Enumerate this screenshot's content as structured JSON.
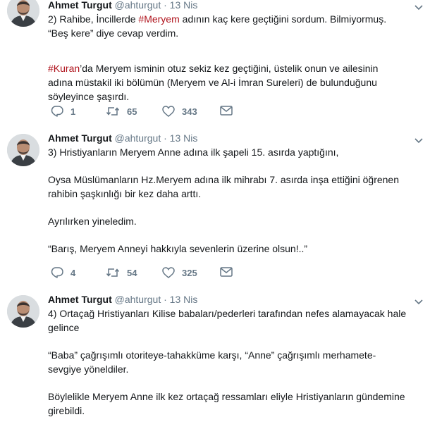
{
  "tweets": [
    {
      "author": "Ahmet Turgut",
      "handle": "@ahturgut",
      "separator": "·",
      "date": "13 Nis",
      "p1_a": "2) Rahibe, İncillerde ",
      "p1_hash": "#Meryem",
      "p1_b": " adının kaç kere geçtiğini sordum. Bilmiyormuş.",
      "p1_c": "“Beş kere” diye cevap verdim.",
      "p2_hash": "#Kuran",
      "p2_a": "’da Meryem isminin otuz sekiz kez geçtiğini, üstelik onun ve ailesinin",
      "p2_b": "adına müstakil iki bölümün (Meryem ve Al-i İmran Sureleri) de bulunduğunu",
      "p2_c": "söyleyince şaşırdı.",
      "replies": "1",
      "retweets": "65",
      "likes": "343"
    },
    {
      "author": "Ahmet Turgut",
      "handle": "@ahturgut",
      "separator": "·",
      "date": "13 Nis",
      "l1": "3) Hristiyanların Meryem Anne adına ilk şapeli 15. asırda yaptığını,",
      "l2": "Oysa Müslümanların Hz.Meryem adına ilk mihrabı 7. asırda inşa ettiğini öğrenen",
      "l3": "rahibin şaşkınlığı bir kez daha arttı.",
      "l4": "Ayrılırken yineledim.",
      "l5": "“Barış, Meryem Anneyi hakkıyla sevenlerin üzerine olsun!..”",
      "replies": "4",
      "retweets": "54",
      "likes": "325"
    },
    {
      "author": "Ahmet Turgut",
      "handle": "@ahturgut",
      "separator": "·",
      "date": "13 Nis",
      "l1": "4) Ortaçağ Hristiyanları Kilise babaları/pederleri tarafından nefes alamayacak hale",
      "l2": "gelince",
      "l3": "“Baba” çağrışımlı otoriteye-tahakküme karşı, “Anne” çağrışımlı merhamete-",
      "l4": "sevgiye yöneldiler.",
      "l5": "Böylelikle Meryem Anne ilk kez ortaçağ ressamları eliyle Hristiyanların gündemine",
      "l6": "girebildi."
    }
  ],
  "colors": {
    "hashtag": "#b0151e",
    "meta": "#657786",
    "divider": "#e6ecf0"
  },
  "icons": [
    "reply-icon",
    "retweet-icon",
    "like-icon",
    "dm-icon",
    "chevron-down-icon"
  ]
}
